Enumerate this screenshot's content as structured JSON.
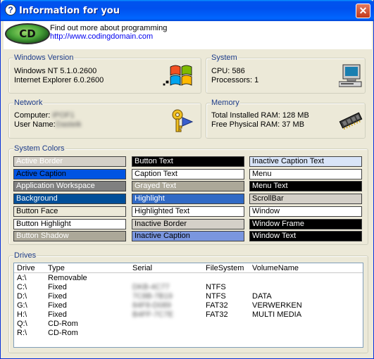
{
  "window": {
    "title": "Information for you",
    "title_icon_glyph": "?",
    "close_glyph": "✕"
  },
  "banner": {
    "logo_text": "CD",
    "line1": "Find out more about programming",
    "link": "http://www.codingdomain.com"
  },
  "windows_version": {
    "legend": "Windows Version",
    "os": "Windows NT 5.1.0.2600",
    "ie": "Internet Explorer 6.0.2600",
    "icon": "windows-flag-icon"
  },
  "system": {
    "legend": "System",
    "cpu": "CPU: 586",
    "processors": "Processors: 1",
    "icon": "computer-icon"
  },
  "network": {
    "legend": "Network",
    "computer_label": "Computer:",
    "computer_value": "IPOF1",
    "user_label": "User Name:",
    "user_value": "Dasteik",
    "icon": "key-icon"
  },
  "memory": {
    "legend": "Memory",
    "total": "Total Installed RAM: 128 MB",
    "free": "Free Physical RAM: 37 MB",
    "icon": "memory-chip-icon"
  },
  "system_colors": {
    "legend": "System Colors",
    "columns": [
      [
        {
          "label": "Active Border",
          "bg": "#d4d0c8",
          "fg": "#ffffff"
        },
        {
          "label": "Active Caption",
          "bg": "#0054e3",
          "fg": "#000000"
        },
        {
          "label": "Application Workspace",
          "bg": "#808080",
          "fg": "#ffffff"
        },
        {
          "label": "Background",
          "bg": "#004e98",
          "fg": "#ffffff"
        },
        {
          "label": "Button Face",
          "bg": "#ece9d8",
          "fg": "#000000"
        },
        {
          "label": "Button Highlight",
          "bg": "#ffffff",
          "fg": "#000000"
        },
        {
          "label": "Button Shadow",
          "bg": "#aca899",
          "fg": "#ffffff"
        }
      ],
      [
        {
          "label": "Button Text",
          "bg": "#000000",
          "fg": "#ffffff"
        },
        {
          "label": "Caption Text",
          "bg": "#ffffff",
          "fg": "#000000"
        },
        {
          "label": "Grayed Text",
          "bg": "#aca899",
          "fg": "#ffffff"
        },
        {
          "label": "Highlight",
          "bg": "#316ac5",
          "fg": "#ffffff"
        },
        {
          "label": "Highlighted Text",
          "bg": "#ffffff",
          "fg": "#000000"
        },
        {
          "label": "Inactive Border",
          "bg": "#d4d0c8",
          "fg": "#000000"
        },
        {
          "label": "Inactive Caption",
          "bg": "#7a96df",
          "fg": "#000000"
        }
      ],
      [
        {
          "label": "Inactive Caption Text",
          "bg": "#d8e4f8",
          "fg": "#000000"
        },
        {
          "label": "Menu",
          "bg": "#ffffff",
          "fg": "#000000"
        },
        {
          "label": "Menu Text",
          "bg": "#000000",
          "fg": "#ffffff"
        },
        {
          "label": "ScrollBar",
          "bg": "#d4d0c8",
          "fg": "#000000"
        },
        {
          "label": "Window",
          "bg": "#ffffff",
          "fg": "#000000"
        },
        {
          "label": "Window Frame",
          "bg": "#000000",
          "fg": "#ffffff"
        },
        {
          "label": "Window Text",
          "bg": "#000000",
          "fg": "#ffffff"
        }
      ]
    ]
  },
  "drives": {
    "legend": "Drives",
    "headers": [
      "Drive",
      "Type",
      "Serial",
      "FileSystem",
      "VolumeName"
    ],
    "rows": [
      {
        "drive": "A:\\",
        "type": "Removable",
        "serial": "",
        "fs": "",
        "volume": ""
      },
      {
        "drive": "C:\\",
        "type": "Fixed",
        "serial": "DKB-4C77",
        "fs": "NTFS",
        "volume": ""
      },
      {
        "drive": "D:\\",
        "type": "Fixed",
        "serial": "7C8B-7B19",
        "fs": "NTFS",
        "volume": "DATA"
      },
      {
        "drive": "G:\\",
        "type": "Fixed",
        "serial": "84F8-D089",
        "fs": "FAT32",
        "volume": "VERWERKEN"
      },
      {
        "drive": "H:\\",
        "type": "Fixed",
        "serial": "B4FF-7C7E",
        "fs": "FAT32",
        "volume": "MULTI MEDIA"
      },
      {
        "drive": "Q:\\",
        "type": "CD-Rom",
        "serial": "",
        "fs": "",
        "volume": ""
      },
      {
        "drive": "R:\\",
        "type": "CD-Rom",
        "serial": "",
        "fs": "",
        "volume": ""
      }
    ]
  }
}
